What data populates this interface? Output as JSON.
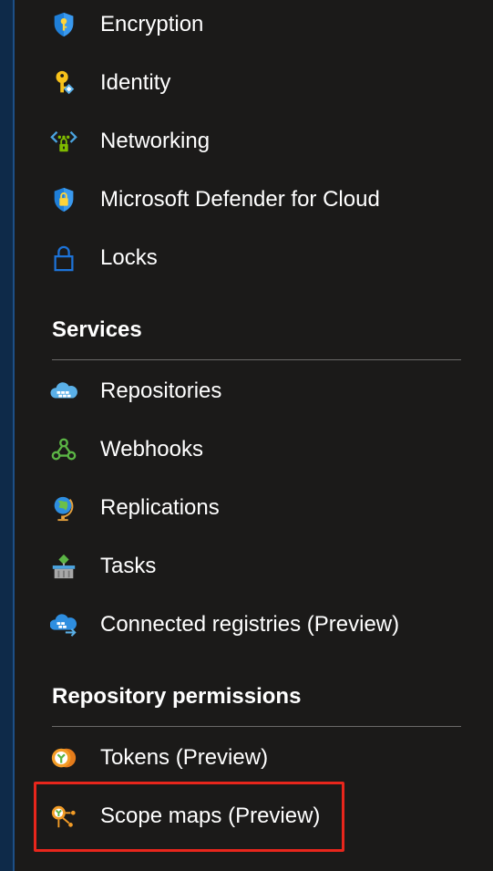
{
  "menu": {
    "security_items": [
      {
        "label": "Encryption",
        "icon": "shield-key-icon"
      },
      {
        "label": "Identity",
        "icon": "identity-key-icon"
      },
      {
        "label": "Networking",
        "icon": "networking-icon"
      },
      {
        "label": "Microsoft Defender for Cloud",
        "icon": "defender-shield-icon"
      },
      {
        "label": "Locks",
        "icon": "lock-icon"
      }
    ],
    "services_heading": "Services",
    "services_items": [
      {
        "label": "Repositories",
        "icon": "repositories-icon"
      },
      {
        "label": "Webhooks",
        "icon": "webhooks-icon"
      },
      {
        "label": "Replications",
        "icon": "replications-globe-icon"
      },
      {
        "label": "Tasks",
        "icon": "tasks-icon"
      },
      {
        "label": "Connected registries (Preview)",
        "icon": "connected-registries-icon"
      }
    ],
    "permissions_heading": "Repository permissions",
    "permissions_items": [
      {
        "label": "Tokens (Preview)",
        "icon": "tokens-icon"
      },
      {
        "label": "Scope maps (Preview)",
        "icon": "scope-maps-icon",
        "highlighted": true
      }
    ]
  },
  "colors": {
    "background": "#1b1a19",
    "highlight": "#e8261c",
    "rail": "#0e2a49"
  }
}
